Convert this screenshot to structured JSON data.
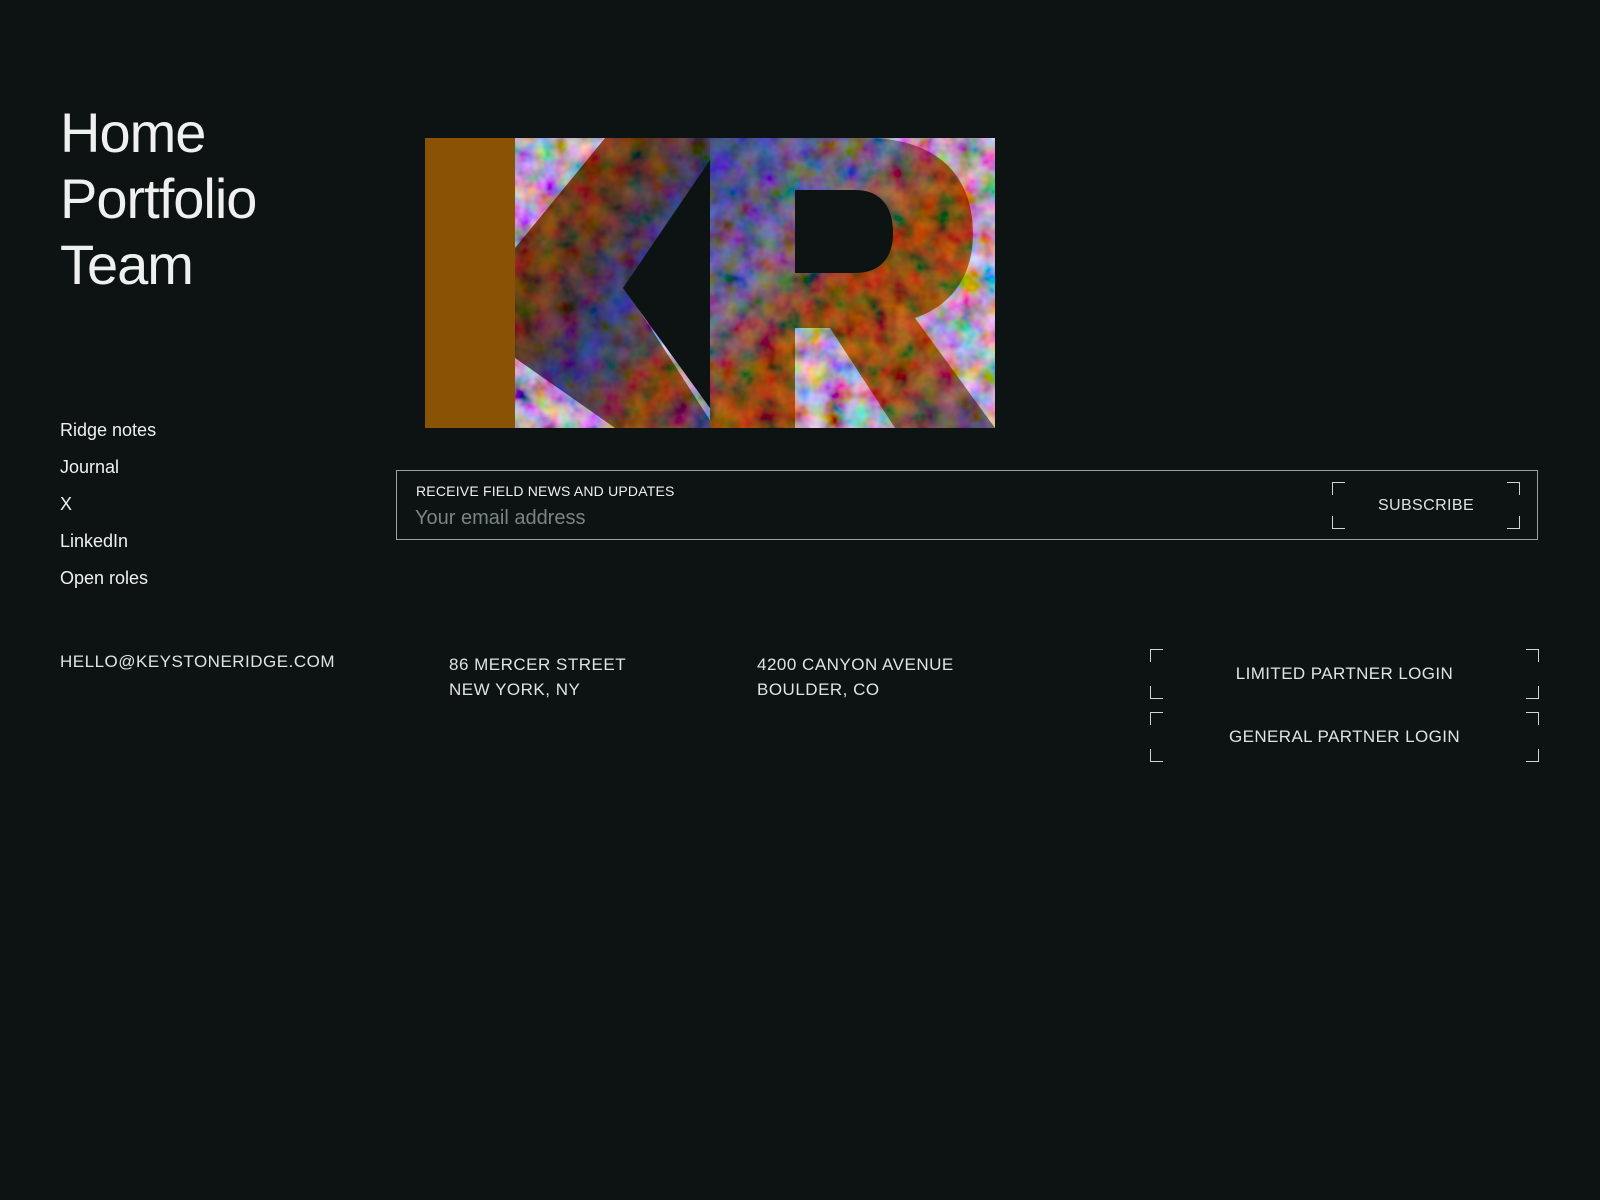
{
  "primary_nav": {
    "items": [
      {
        "label": "Home"
      },
      {
        "label": "Portfolio"
      },
      {
        "label": "Team"
      }
    ]
  },
  "secondary_nav": {
    "items": [
      {
        "label": "Ridge notes"
      },
      {
        "label": "Journal"
      },
      {
        "label": "X"
      },
      {
        "label": "LinkedIn"
      },
      {
        "label": "Open roles"
      }
    ]
  },
  "logo": {
    "letters": "KR",
    "icon": "kr-monogram-logo",
    "colors": {
      "amber": "#8a5204",
      "orange": "#c7741a",
      "blue": "#5a72c8",
      "slate": "#6b7790"
    }
  },
  "newsletter": {
    "label": "RECEIVE FIELD NEWS AND UPDATES",
    "placeholder": "Your email address",
    "value": "",
    "subscribe_label": "SUBSCRIBE"
  },
  "footer": {
    "email": "HELLO@KEYSTONERIDGE.COM",
    "addresses": [
      {
        "line1": "86 MERCER STREET",
        "line2": "NEW YORK, NY"
      },
      {
        "line1": "4200 CANYON AVENUE",
        "line2": "BOULDER, CO"
      }
    ],
    "lp_login_label": "LIMITED PARTNER LOGIN",
    "gp_login_label": "GENERAL PARTNER LOGIN"
  },
  "colors": {
    "background": "#0c1312",
    "text": "#eef1ef",
    "border": "#9aa3a0",
    "placeholder": "#7b8582"
  }
}
